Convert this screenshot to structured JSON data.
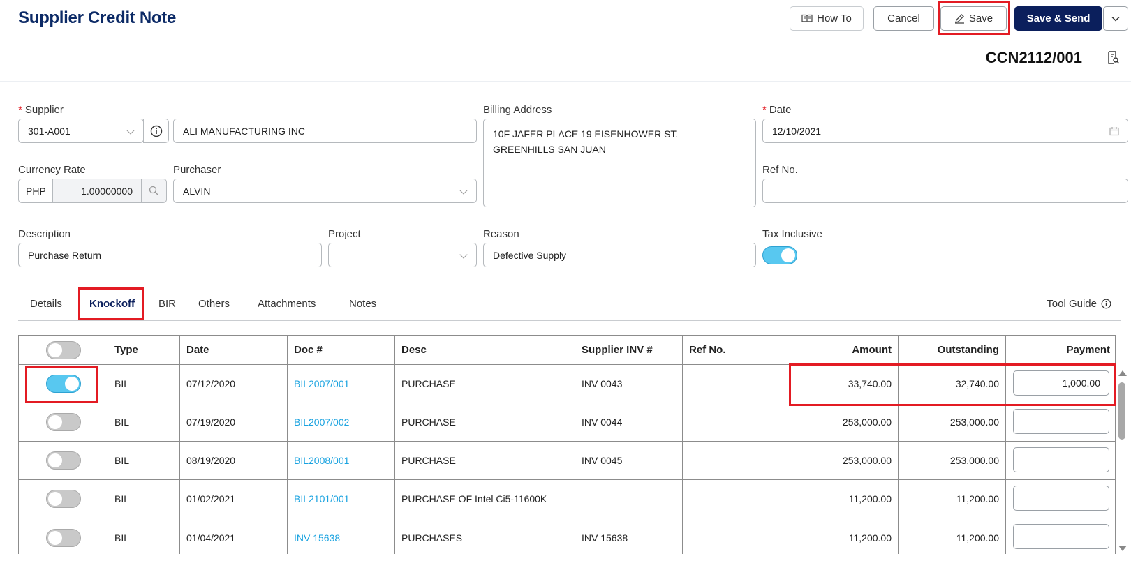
{
  "header": {
    "title": "Supplier Credit Note",
    "how_to": "How To",
    "cancel": "Cancel",
    "save": "Save",
    "save_send": "Save & Send",
    "doc_number": "CCN2112/001"
  },
  "form": {
    "supplier_label": "Supplier",
    "supplier_code": "301-A001",
    "supplier_name": "ALI MANUFACTURING INC",
    "billing_label": "Billing Address",
    "billing_line1": "10F JAFER PLACE 19 EISENHOWER ST.",
    "billing_line2": "GREENHILLS SAN JUAN",
    "date_label": "Date",
    "date_value": "12/10/2021",
    "currency_label": "Currency Rate",
    "currency_code": "PHP",
    "currency_rate": "1.00000000",
    "purchaser_label": "Purchaser",
    "purchaser_value": "ALVIN",
    "refno_label": "Ref No.",
    "refno_value": "",
    "description_label": "Description",
    "description_value": "Purchase Return",
    "project_label": "Project",
    "project_value": "",
    "reason_label": "Reason",
    "reason_value": "Defective Supply",
    "tax_label": "Tax Inclusive",
    "tax_inclusive": true
  },
  "tabs": {
    "details": "Details",
    "knockoff": "Knockoff",
    "bir": "BIR",
    "others": "Others",
    "attachments": "Attachments",
    "notes": "Notes",
    "active": "Knockoff",
    "tool_guide": "Tool Guide"
  },
  "table": {
    "headers": {
      "type": "Type",
      "date": "Date",
      "doc": "Doc #",
      "desc": "Desc",
      "supplier_inv": "Supplier INV #",
      "ref": "Ref No.",
      "amount": "Amount",
      "outstanding": "Outstanding",
      "payment": "Payment"
    },
    "rows": [
      {
        "selected": true,
        "type": "BIL",
        "date": "07/12/2020",
        "doc": "BIL2007/001",
        "desc": "PURCHASE",
        "inv": "INV 0043",
        "ref": "",
        "amount": "33,740.00",
        "outstanding": "32,740.00",
        "payment": "1,000.00"
      },
      {
        "selected": false,
        "type": "BIL",
        "date": "07/19/2020",
        "doc": "BIL2007/002",
        "desc": "PURCHASE",
        "inv": "INV 0044",
        "ref": "",
        "amount": "253,000.00",
        "outstanding": "253,000.00",
        "payment": ""
      },
      {
        "selected": false,
        "type": "BIL",
        "date": "08/19/2020",
        "doc": "BIL2008/001",
        "desc": "PURCHASE",
        "inv": "INV 0045",
        "ref": "",
        "amount": "253,000.00",
        "outstanding": "253,000.00",
        "payment": ""
      },
      {
        "selected": false,
        "type": "BIL",
        "date": "01/02/2021",
        "doc": "BIL2101/001",
        "desc": "PURCHASE OF Intel Ci5-11600K",
        "inv": "",
        "ref": "",
        "amount": "11,200.00",
        "outstanding": "11,200.00",
        "payment": ""
      },
      {
        "selected": false,
        "type": "BIL",
        "date": "01/04/2021",
        "doc": "INV 15638",
        "desc": "PURCHASES",
        "inv": "INV 15638",
        "ref": "",
        "amount": "11,200.00",
        "outstanding": "11,200.00",
        "payment": ""
      }
    ]
  },
  "colors": {
    "brand_navy": "#0b1f5c",
    "title_blue": "#0c2a66",
    "link_blue": "#1aa3e0",
    "toggle_on": "#58c8f0",
    "highlight_red": "#e31b23"
  },
  "icons": {
    "how_to": "book-icon",
    "save": "pencil-icon",
    "dropdown": "chevron-down-icon",
    "supplier_info": "info-icon",
    "currency_search": "search-icon",
    "date": "calendar-icon",
    "doc": "document-search-icon",
    "tool_guide": "info-icon"
  }
}
